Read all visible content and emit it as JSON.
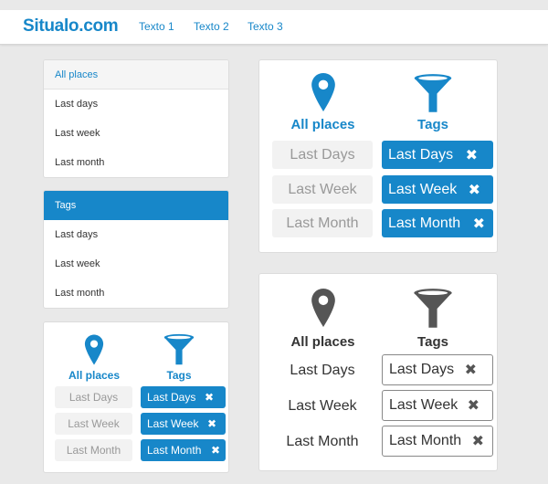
{
  "nav": {
    "brand": "Situalo.com",
    "links": [
      "Texto 1",
      "Texto 2",
      "Texto 3"
    ]
  },
  "places_panel": {
    "items": [
      "All places",
      "Last days",
      "Last week",
      "Last month"
    ]
  },
  "tags_panel": {
    "items": [
      "Tags",
      "Last days",
      "Last week",
      "Last month"
    ]
  },
  "filter_cards": {
    "places_label": "All places",
    "tags_label": "Tags",
    "places_options": [
      "Last Days",
      "Last Week",
      "Last Month"
    ],
    "tag_options": [
      "Last Days",
      "Last Week",
      "Last Month"
    ],
    "remove_glyph": "✖"
  },
  "colors": {
    "accent": "#1787c9",
    "dark": "#555555",
    "muted": "#999999"
  },
  "icons": {
    "place": "map-pin-icon",
    "tags": "funnel-icon",
    "remove": "close-icon"
  }
}
